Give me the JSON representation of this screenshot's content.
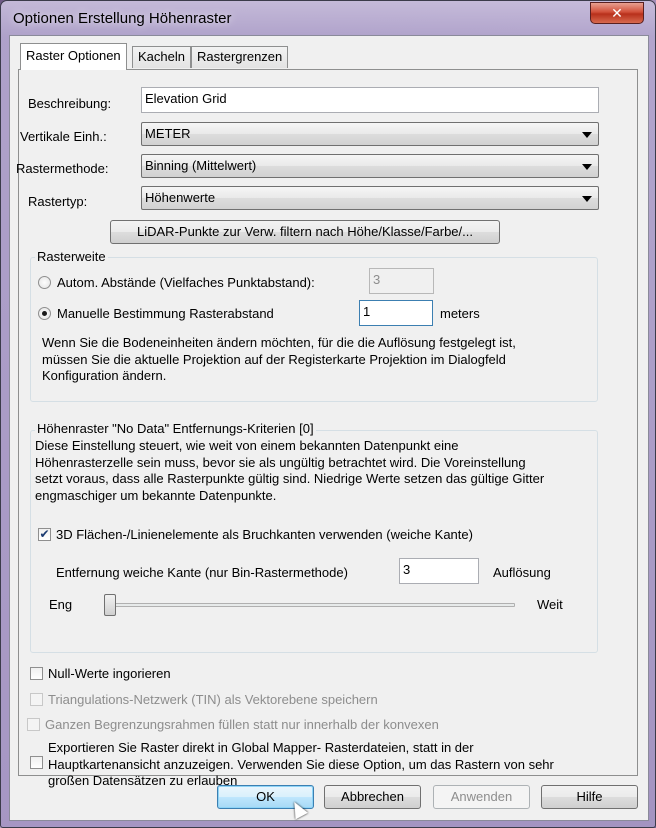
{
  "window": {
    "title": "Optionen Erstellung Höhenraster",
    "close_glyph": "✕"
  },
  "tabs": [
    {
      "label": "Raster Optionen",
      "active": true
    },
    {
      "label": "Kacheln",
      "active": false
    },
    {
      "label": "Rastergrenzen",
      "active": false
    }
  ],
  "form": {
    "description_label": "Beschreibung:",
    "description_value": "Elevation Grid",
    "vertical_units_label": "Vertikale Einh.:",
    "vertical_units_value": "METER",
    "grid_method_label": "Rastermethode:",
    "grid_method_value": "Binning (Mittelwert)",
    "grid_type_label": "Rastertyp:",
    "grid_type_value": "Höhenwerte",
    "lidar_filter_button": "LiDAR-Punkte zur Verw. filtern nach Höhe/Klasse/Farbe/..."
  },
  "spacing": {
    "title": "Rasterweite",
    "auto_label": "Autom. Abstände (Vielfaches Punktabstand):",
    "auto_value": "3",
    "auto_checked": false,
    "manual_label": "Manuelle Bestimmung Rasterabstand",
    "manual_value": "1",
    "manual_checked": true,
    "unit": "meters",
    "note": "Wenn Sie die Bodeneinheiten ändern möchten, für die die Auflösung festgelegt ist, müssen Sie die aktuelle Projektion auf der Registerkarte Projektion im Dialogfeld Konfiguration ändern."
  },
  "nodata": {
    "title": "Höhenraster \"No Data\" Entfernungs-Kriterien [0]",
    "description": "Diese Einstellung steuert, wie weit von einem bekannten Datenpunkt eine Höhenrasterzelle sein muss, bevor sie als ungültig betrachtet wird. Die Voreinstellung setzt voraus, dass alle Rasterpunkte gültig sind. Niedrige Werte setzen das gültige Gitter engmaschiger um bekannte Datenpunkte.",
    "breakline_label": "3D Flächen-/Linienelemente als Bruchkanten verwenden (weiche Kante)",
    "breakline_checked": true,
    "soft_edge_label": "Entfernung weiche Kante (nur Bin-Rastermethode)",
    "soft_edge_value": "3",
    "soft_edge_unit": "Auflösung",
    "slider_min_label": "Eng",
    "slider_max_label": "Weit",
    "slider_position": 0
  },
  "options": {
    "null_values_label": "Null-Werte ingorieren",
    "null_values_checked": false,
    "tin_label": "Triangulations-Netzwerk (TIN) als Vektorebene speichern",
    "tin_enabled": false,
    "fill_bounds_label": "Ganzen Begrenzungsrahmen füllen statt nur innerhalb der konvexen",
    "fill_bounds_enabled": false,
    "export_direct_label": "Exportieren Sie Raster direkt in Global Mapper- Rasterdateien, statt in der Hauptkartenansicht anzuzeigen. Verwenden Sie diese Option, um das Rastern von sehr großen Datensätzen zu erlauben",
    "export_direct_checked": false
  },
  "buttons": {
    "ok": "OK",
    "cancel": "Abbrechen",
    "apply": "Anwenden",
    "help": "Hilfe"
  }
}
